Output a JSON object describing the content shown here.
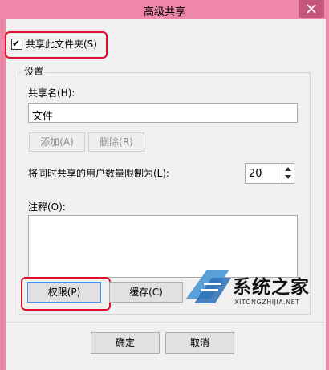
{
  "window": {
    "title": "高级共享"
  },
  "share_checkbox": {
    "label": "共享此文件夹(S)",
    "checked": true
  },
  "settings": {
    "group_label": "设置",
    "share_name_label": "共享名(H):",
    "share_name_value": "文件",
    "add_label": "添加(A)",
    "remove_label": "删除(R)",
    "limit_label": "将同时共享的用户数量限制为(L):",
    "limit_value": "20",
    "comment_label": "注释(O):",
    "comment_value": "",
    "permissions_label": "权限(P)",
    "caching_label": "缓存(C)"
  },
  "footer": {
    "ok_label": "确定",
    "cancel_label": "取消"
  },
  "watermark": {
    "text": "系统之家",
    "subtext": "XITONGZHIJIA.NET"
  },
  "colors": {
    "titlebar": "#ef88a8",
    "close": "#c6567c",
    "highlight": "#e0102a"
  }
}
